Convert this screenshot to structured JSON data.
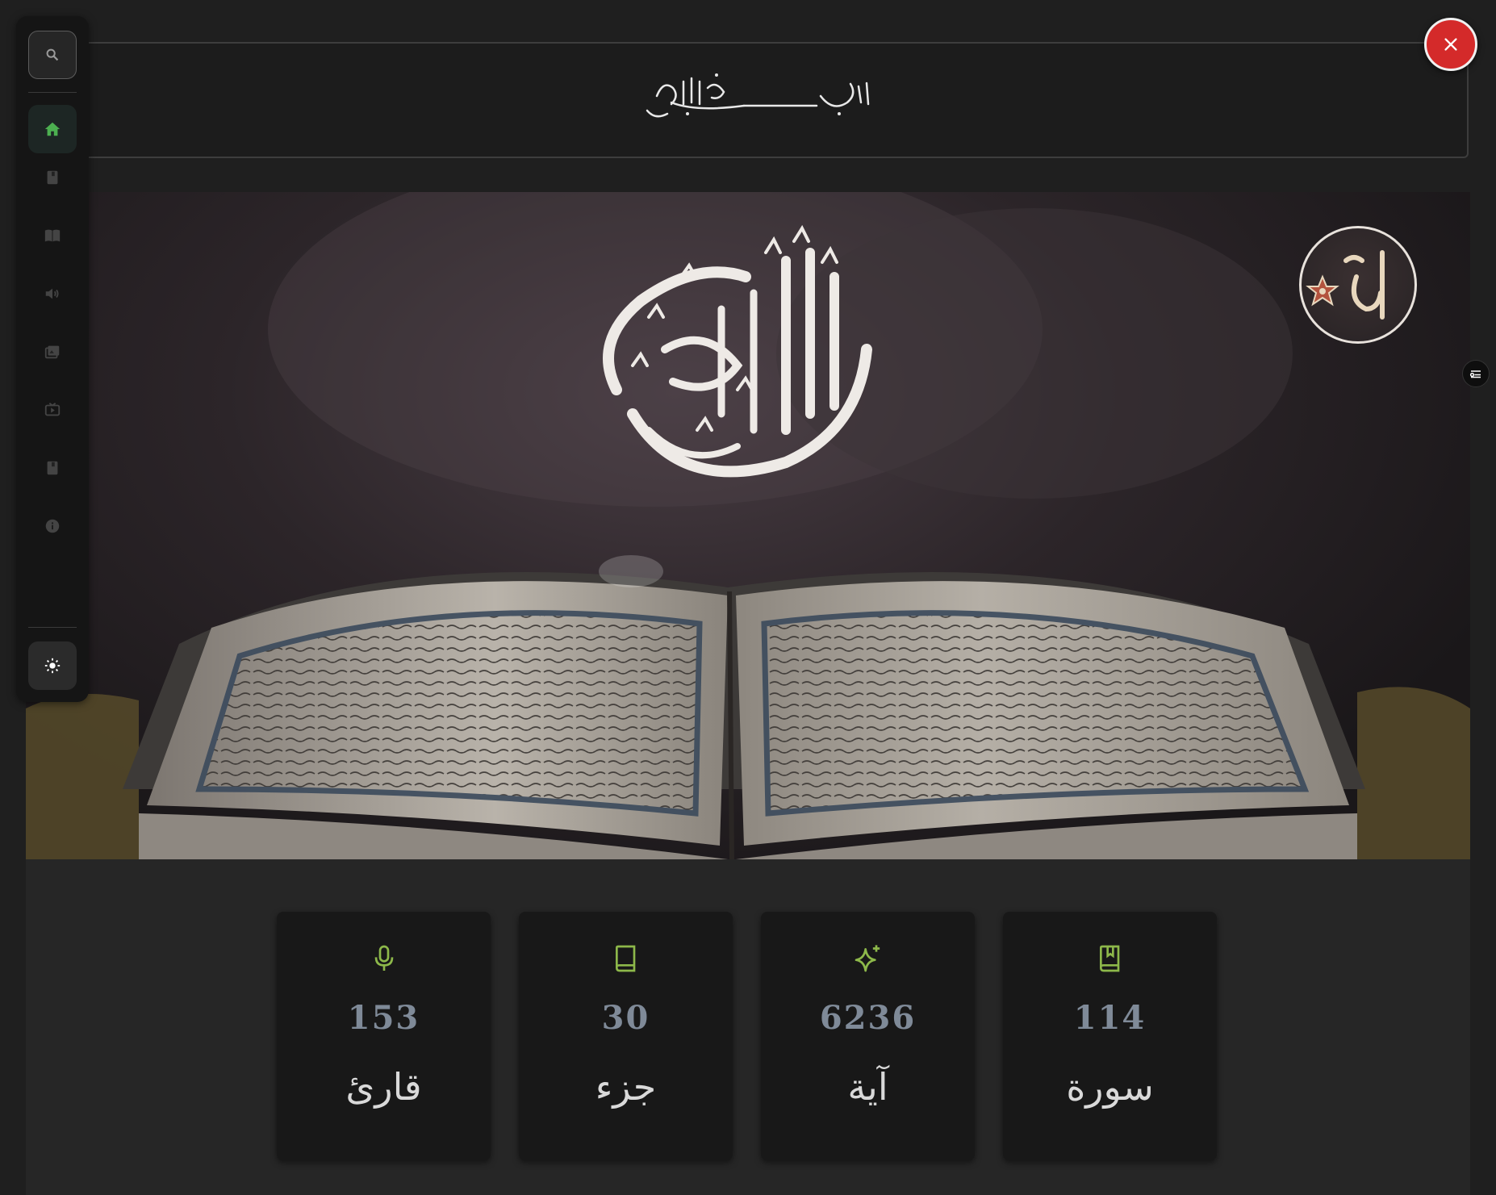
{
  "header": {
    "basmala": "بسم الله الرحمن الرحيم"
  },
  "sidebar": {
    "items": [
      {
        "icon": "search-icon"
      },
      {
        "icon": "home-icon",
        "active": true
      },
      {
        "icon": "book-icon"
      },
      {
        "icon": "open-book-icon"
      },
      {
        "icon": "speaker-icon"
      },
      {
        "icon": "gallery-icon"
      },
      {
        "icon": "tv-icon"
      },
      {
        "icon": "bookmark-book-icon"
      },
      {
        "icon": "info-icon"
      },
      {
        "icon": "sun-icon"
      }
    ],
    "active_color": "#4caf50"
  },
  "hero": {
    "title": "القرآن الكريم",
    "seal_text": "الٓمٓ"
  },
  "stats": [
    {
      "icon": "microphone-icon",
      "value": "153",
      "label": "قارئ"
    },
    {
      "icon": "book-icon",
      "value": "30",
      "label": "جزء"
    },
    {
      "icon": "sparkles-icon",
      "value": "6236",
      "label": "آية"
    },
    {
      "icon": "bookmark-book-icon",
      "value": "114",
      "label": "سورة"
    }
  ],
  "colors": {
    "accent": "#8db84a",
    "close": "#d42a2a"
  }
}
